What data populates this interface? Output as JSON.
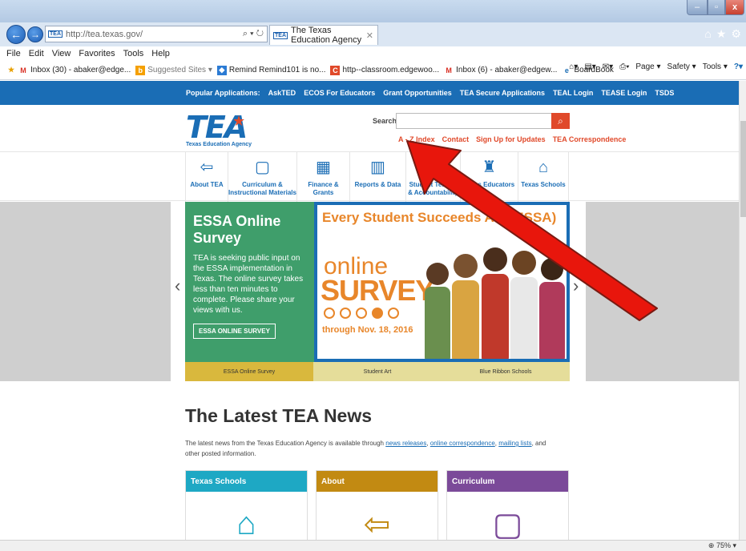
{
  "browser": {
    "url": "http://tea.texas.gov/",
    "favicon_text": "TEA",
    "tab_title": "The Texas Education Agency",
    "menu": [
      "File",
      "Edit",
      "View",
      "Favorites",
      "Tools",
      "Help"
    ],
    "favorites": [
      {
        "icon": "gmail-icon",
        "label": "Inbox (30) - abaker@edge..."
      },
      {
        "icon": "bing-icon",
        "label": "Suggested Sites ▾"
      },
      {
        "icon": "remind-icon",
        "label": "Remind Remind101 is no..."
      },
      {
        "icon": "classroom-icon",
        "label": "http--classroom.edgewoo..."
      },
      {
        "icon": "gmail-icon",
        "label": "Inbox (6) - abaker@edgew..."
      },
      {
        "icon": "boardbook-icon",
        "label": "BoardBook"
      }
    ],
    "ie_tools": [
      "Page ▾",
      "Safety ▾",
      "Tools ▾"
    ],
    "zoom": "75%"
  },
  "site": {
    "popular_apps": [
      "Popular Applications:",
      "AskTED",
      "ECOS For Educators",
      "Grant Opportunities",
      "TEA Secure Applications",
      "TEAL Login",
      "TEASE Login",
      "TSDS"
    ],
    "logo_text": "TEA",
    "logo_sub": "Texas Education Agency",
    "search_label": "Search",
    "util_links": [
      "A - Z Index",
      "Contact",
      "Sign Up for Updates",
      "TEA Correspondence"
    ],
    "nav": [
      {
        "icon": "⇦",
        "label": "About TEA"
      },
      {
        "icon": "▢",
        "label": "Curriculum & Instructional Materials"
      },
      {
        "icon": "▦",
        "label": "Finance & Grants"
      },
      {
        "icon": "▥",
        "label": "Reports & Data"
      },
      {
        "icon": "▣",
        "label": "Student Testing & Accountability"
      },
      {
        "icon": "♜",
        "label": "Texas Educators"
      },
      {
        "icon": "⌂",
        "label": "Texas Schools"
      }
    ]
  },
  "hero": {
    "title": "ESSA Online Survey",
    "desc": "TEA is seeking public input on the ESSA implementation in Texas. The online survey takes less than ten minutes to complete. Please share your views with us.",
    "cta": "ESSA ONLINE SURVEY",
    "heading": "Every Student Succeeds Act (ESSA)",
    "online": "online",
    "survey": "SURVEY",
    "date": "through Nov. 18, 2016",
    "strip_tabs": [
      "ESSA Online Survey",
      "Student Art",
      "Blue Ribbon Schools"
    ]
  },
  "news": {
    "title": "The Latest TEA News",
    "desc_prefix": "The latest news from the Texas Education Agency is available through",
    "link1": "news releases",
    "link2": "online correspondence",
    "link3": "mailing lists",
    "desc_suffix": "and other posted information.",
    "cards": [
      {
        "label": "Texas Schools",
        "color": "#1ea8c4"
      },
      {
        "label": "About",
        "color": "#c28a12"
      },
      {
        "label": "Curriculum",
        "color": "#7b4a99"
      }
    ]
  }
}
